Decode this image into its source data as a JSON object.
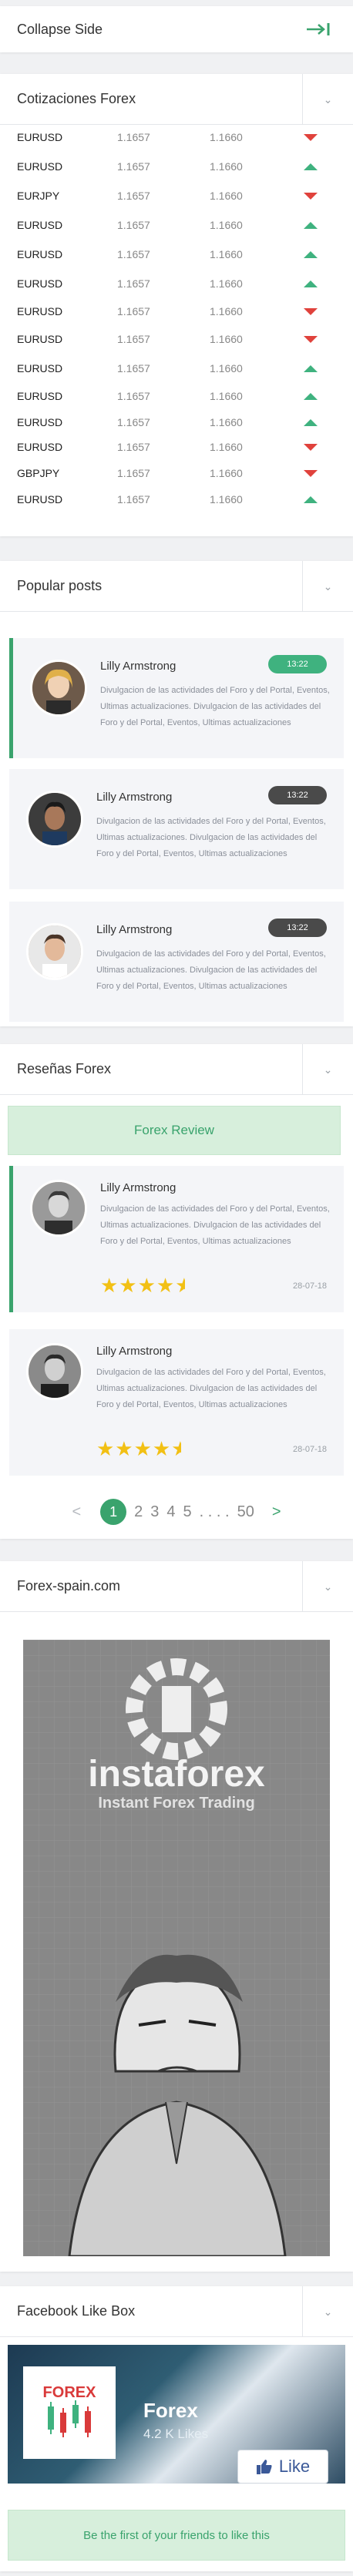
{
  "collapse": {
    "label": "Collapse Side"
  },
  "quotes": {
    "title": "Cotizaciones Forex",
    "rows": [
      {
        "pair": "EURUSD",
        "bid": "1.1657",
        "ask": "1.1660",
        "dir": "down"
      },
      {
        "pair": "EURUSD",
        "bid": "1.1657",
        "ask": "1.1660",
        "dir": "up"
      },
      {
        "pair": "EURJPY",
        "bid": "1.1657",
        "ask": "1.1660",
        "dir": "down"
      },
      {
        "pair": "EURUSD",
        "bid": "1.1657",
        "ask": "1.1660",
        "dir": "up"
      },
      {
        "pair": "EURUSD",
        "bid": "1.1657",
        "ask": "1.1660",
        "dir": "up"
      },
      {
        "pair": "EURUSD",
        "bid": "1.1657",
        "ask": "1.1660",
        "dir": "up"
      },
      {
        "pair": "EURUSD",
        "bid": "1.1657",
        "ask": "1.1660",
        "dir": "down"
      },
      {
        "pair": "EURUSD",
        "bid": "1.1657",
        "ask": "1.1660",
        "dir": "down"
      },
      {
        "pair": "EURUSD",
        "bid": "1.1657",
        "ask": "1.1660",
        "dir": "up"
      },
      {
        "pair": "EURUSD",
        "bid": "1.1657",
        "ask": "1.1660",
        "dir": "up"
      },
      {
        "pair": "EURUSD",
        "bid": "1.1657",
        "ask": "1.1660",
        "dir": "up"
      },
      {
        "pair": "EURUSD",
        "bid": "1.1657",
        "ask": "1.1660",
        "dir": "down"
      },
      {
        "pair": "GBPJPY",
        "bid": "1.1657",
        "ask": "1.1660",
        "dir": "down"
      },
      {
        "pair": "EURUSD",
        "bid": "1.1657",
        "ask": "1.1660",
        "dir": "up"
      }
    ]
  },
  "posts": {
    "title": "Popular posts",
    "items": [
      {
        "name": "Lilly Armstrong",
        "time": "13:22",
        "badge_color": "#3fb27f",
        "text": "Divulgacion de las actividades del Foro y del Portal, Eventos, Ultimas actualizaciones. Divulgacion de las actividades del Foro y del Portal, Eventos, Ultimas actualizaciones"
      },
      {
        "name": "Lilly Armstrong",
        "time": "13:22",
        "badge_color": "#4a4a4a",
        "text": "Divulgacion de las actividades del Foro y del Portal, Eventos, Ultimas actualizaciones. Divulgacion de las actividades del Foro y del Portal, Eventos, Ultimas actualizaciones"
      },
      {
        "name": "Lilly Armstrong",
        "time": "13:22",
        "badge_color": "#4a4a4a",
        "text": "Divulgacion de las actividades del Foro y del Portal, Eventos, Ultimas actualizaciones. Divulgacion de las actividades del Foro y del Portal, Eventos, Ultimas actualizaciones"
      }
    ]
  },
  "reviews": {
    "title": "Reseñas Forex",
    "button": "Forex Review",
    "items": [
      {
        "name": "Lilly Armstrong",
        "text": "Divulgacion de las actividades del Foro y del Portal, Eventos, Ultimas actualizaciones. Divulgacion de las actividades del Foro y del Portal, Eventos, Ultimas actualizaciones",
        "rating": 4.5,
        "date": "28-07-18"
      },
      {
        "name": "Lilly Armstrong",
        "text": "Divulgacion de las actividades del Foro y del Portal, Eventos, Ultimas actualizaciones. Divulgacion de las actividades del Foro y del Portal, Eventos, Ultimas actualizaciones",
        "rating": 4.5,
        "date": "28-07-18"
      }
    ],
    "pager": {
      "prev": "<",
      "pages": [
        "1",
        "2",
        "3",
        "4",
        "5"
      ],
      "ellipsis": ". . . .",
      "last": "50",
      "next": ">"
    }
  },
  "spain": {
    "title": "Forex-spain.com",
    "banner_brand": "instaforex",
    "banner_tagline": "Instant Forex Trading"
  },
  "facebook": {
    "title": "Facebook Like Box",
    "page_name": "Forex",
    "likes": "4.2 K Likes",
    "logo_text": "FOREX",
    "like_label": "Like",
    "friends_text": "Be the first of your friends to like this"
  },
  "colors": {
    "accent": "#3aa36d",
    "up": "#3fb27f",
    "down": "#e0423c",
    "star": "#f2c014"
  }
}
